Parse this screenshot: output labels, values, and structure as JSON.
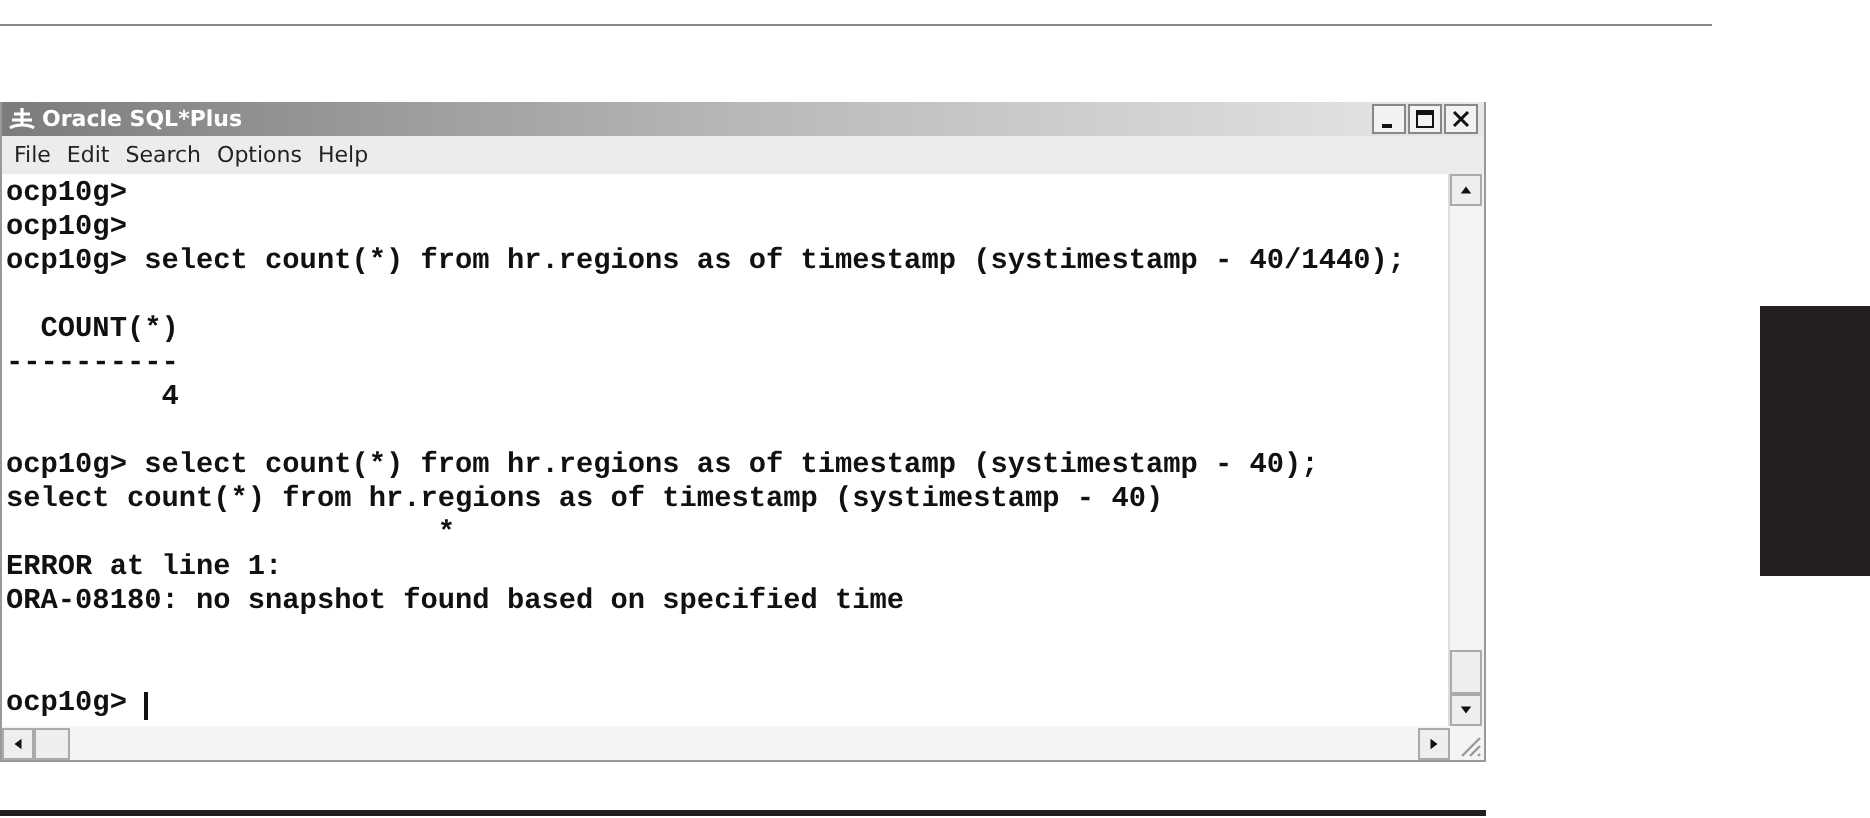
{
  "window": {
    "title": "Oracle SQL*Plus",
    "controls": [
      {
        "kind": "minimize"
      },
      {
        "kind": "maximize"
      },
      {
        "kind": "close"
      }
    ]
  },
  "menu": [
    "File",
    "Edit",
    "Search",
    "Options",
    "Help"
  ],
  "console": [
    {
      "kind": "text",
      "text": "ocp10g>"
    },
    {
      "kind": "text",
      "text": "ocp10g>"
    },
    {
      "kind": "text",
      "text": "ocp10g> select count(*) from hr.regions as of timestamp (systimestamp - 40/1440);"
    },
    {
      "kind": "blank"
    },
    {
      "kind": "text",
      "text": "  COUNT(*)"
    },
    {
      "kind": "text",
      "text": "----------"
    },
    {
      "kind": "text",
      "text": "         4"
    },
    {
      "kind": "blank"
    },
    {
      "kind": "text",
      "text": "ocp10g> select count(*) from hr.regions as of timestamp (systimestamp - 40);"
    },
    {
      "kind": "text",
      "text": "select count(*) from hr.regions as of timestamp (systimestamp - 40)"
    },
    {
      "kind": "text",
      "text": "                         *"
    },
    {
      "kind": "text",
      "text": "ERROR at line 1:"
    },
    {
      "kind": "text",
      "text": "ORA-08180: no snapshot found based on specified time"
    },
    {
      "kind": "blank"
    },
    {
      "kind": "blank"
    },
    {
      "kind": "prompt",
      "text": "ocp10g> "
    }
  ]
}
